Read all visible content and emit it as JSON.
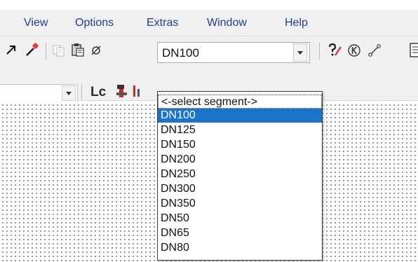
{
  "menu": {
    "items": [
      {
        "label": "View"
      },
      {
        "label": "Options"
      },
      {
        "label": "Extras"
      },
      {
        "label": "Window"
      },
      {
        "label": "Help"
      }
    ]
  },
  "toolbar": {
    "segment_combo": {
      "value": "DN100"
    },
    "icons": [
      "arrow-icon",
      "pipette-icon",
      "copy-icon",
      "paste-icon",
      "empty-set-icon",
      "question-pen-icon",
      "circle-k-icon",
      "line-tool-icon",
      "page-icon"
    ]
  },
  "toolbar2": {
    "lc_label": "Lc"
  },
  "dropdown": {
    "options": [
      "<-select segment->",
      "DN100",
      "DN125",
      "DN150",
      "DN200",
      "DN250",
      "DN300",
      "DN350",
      "DN50",
      "DN65",
      "DN80"
    ],
    "selected_index": 1
  },
  "colors": {
    "menu_text": "#1f3f8c",
    "selection": "#1b74c9",
    "toolbar_bg": "#f0f0f0"
  }
}
